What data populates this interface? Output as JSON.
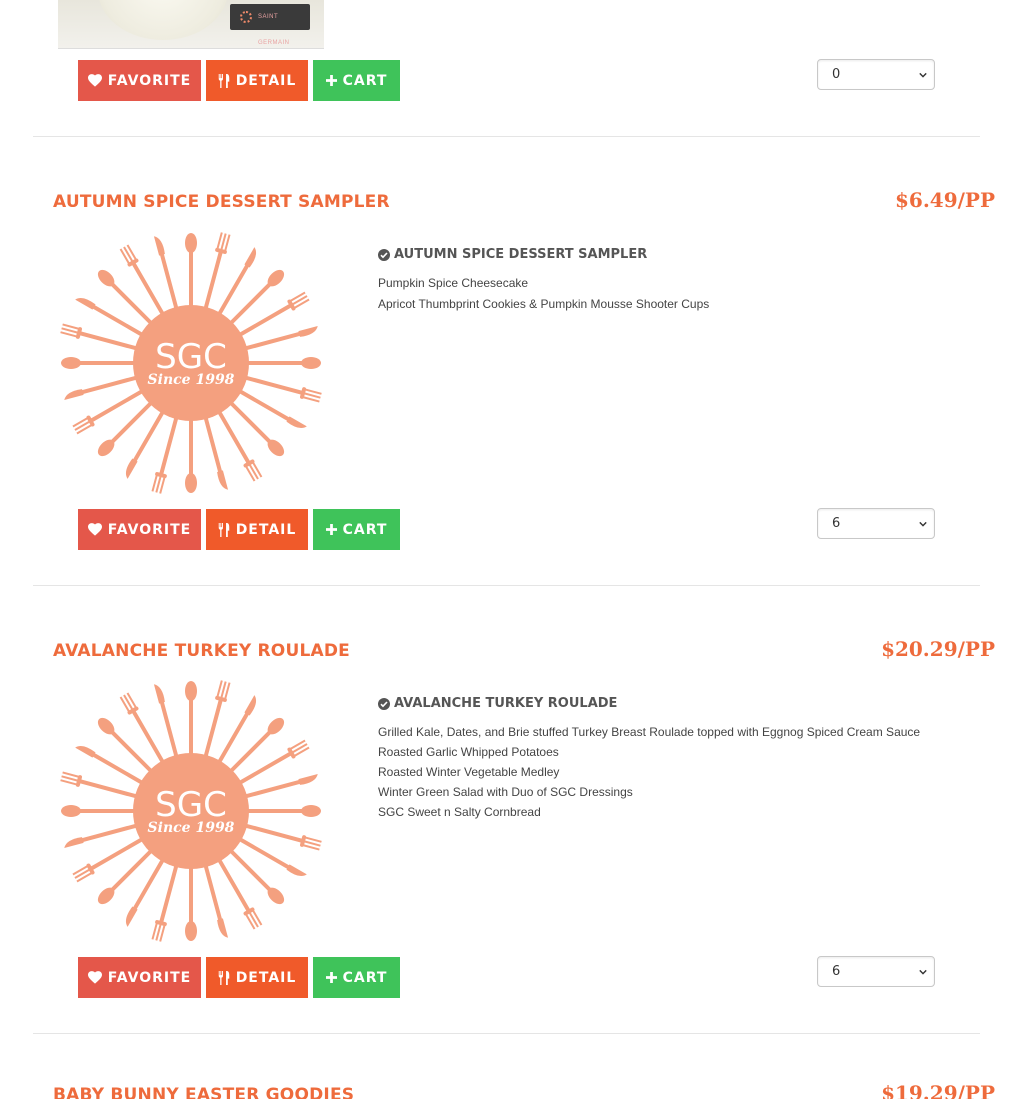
{
  "buttons": {
    "favorite": "FAVORITE",
    "detail": "DETAIL",
    "cart": "CART"
  },
  "colors": {
    "accent": "#ee6b3c",
    "favorite": "#e4574a",
    "detail": "#f05a2a",
    "cart": "#3fc35a",
    "logo": "#f4a07f"
  },
  "top_item": {
    "image_badge_text": "SAINT GERMAIN",
    "quantity": "0"
  },
  "items": [
    {
      "title": "AUTUMN SPICE DESSERT SAMPLER",
      "price": "$6.49/PP",
      "logo_line1": "SGC",
      "logo_line2": "Since 1998",
      "desc_heading": "AUTUMN SPICE DESSERT SAMPLER",
      "desc_lines": [
        " Pumpkin Spice Cheesecake",
        "Apricot Thumbprint Cookies & Pumpkin Mousse Shooter Cups"
      ],
      "quantity": "6"
    },
    {
      "title": "AVALANCHE TURKEY ROULADE",
      "price": "$20.29/PP",
      "logo_line1": "SGC",
      "logo_line2": "Since 1998",
      "desc_heading": "AVALANCHE TURKEY ROULADE",
      "desc_lines": [
        " Grilled Kale, Dates, and Brie stuffed Turkey Breast Roulade topped with Eggnog Spiced Cream Sauce",
        "Roasted Garlic Whipped Potatoes",
        "Roasted Winter Vegetable Medley",
        "Winter Green Salad with Duo of SGC Dressings",
        "SGC Sweet n Salty Cornbread"
      ],
      "quantity": "6"
    },
    {
      "title": "BABY BUNNY EASTER GOODIES",
      "price": "$19.29/PP"
    }
  ]
}
